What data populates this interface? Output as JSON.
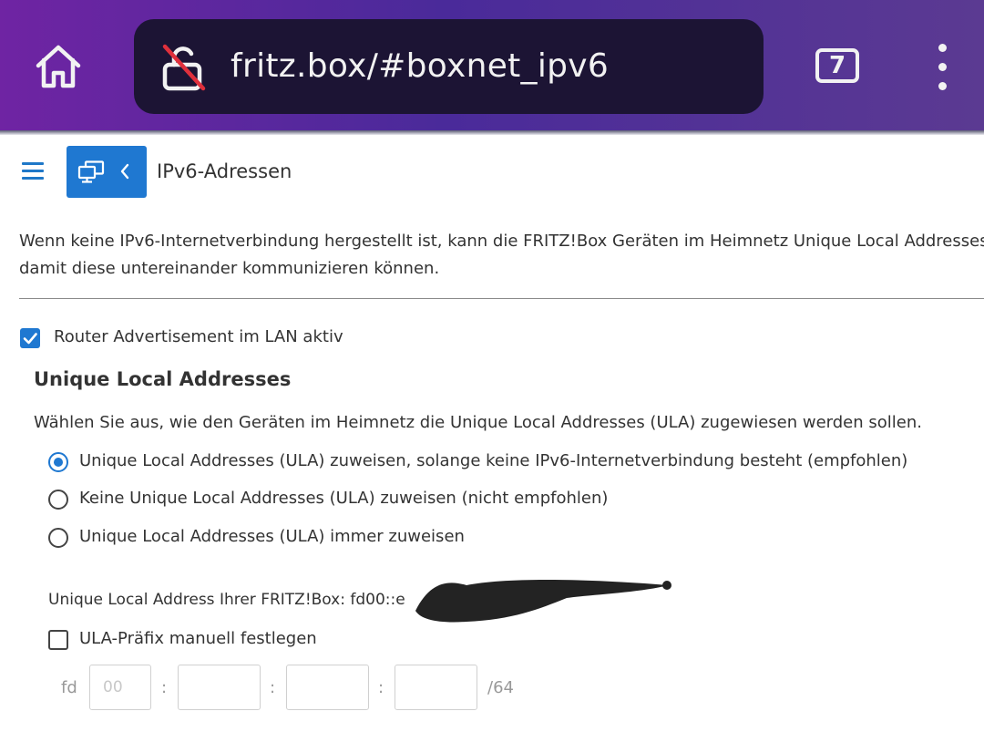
{
  "browser": {
    "url": "fritz.box/#boxnet_ipv6",
    "tab_count": "7"
  },
  "header": {
    "page_title": "IPv6-Adressen"
  },
  "intro": {
    "line1": "Wenn keine IPv6-Internetverbindung hergestellt ist, kann die FRITZ!Box Geräten im Heimnetz Unique Local Addresses (",
    "line2": "damit diese untereinander kommunizieren können."
  },
  "router_advertisement": {
    "label": "Router Advertisement im LAN aktiv",
    "checked": true
  },
  "ula_section": {
    "title": "Unique Local Addresses",
    "description": "Wählen Sie aus, wie den Geräten im Heimnetz die Unique Local Addresses (ULA) zugewiesen werden sollen.",
    "options": [
      {
        "label": "Unique Local Addresses (ULA) zuweisen, solange keine IPv6-Internetverbindung besteht (empfohlen)",
        "selected": true
      },
      {
        "label": "Keine Unique Local Addresses (ULA) zuweisen (nicht empfohlen)",
        "selected": false
      },
      {
        "label": "Unique Local Addresses (ULA) immer zuweisen",
        "selected": false
      }
    ],
    "address_label": "Unique Local Address Ihrer FRITZ!Box: fd00::e",
    "manual_prefix_label": "ULA-Präfix manuell festlegen",
    "manual_prefix_checked": false,
    "prefix_start": "fd",
    "prefix_field1_placeholder": "00",
    "separator": ":",
    "prefix_suffix": "/64"
  },
  "colors": {
    "accent": "#1f78d1",
    "topbar_start": "#6f24a3",
    "urlbar": "#1c1434"
  }
}
